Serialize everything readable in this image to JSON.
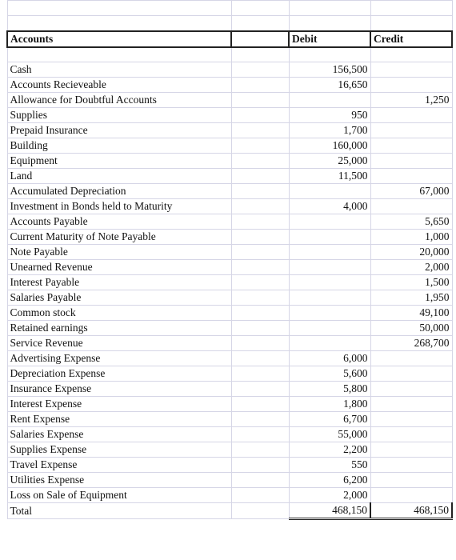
{
  "header": {
    "accounts": "Accounts",
    "blank": "",
    "debit": "Debit",
    "credit": "Credit"
  },
  "rows": [
    {
      "account": "Cash",
      "debit": "156,500",
      "credit": ""
    },
    {
      "account": "Accounts Recieveable",
      "debit": "16,650",
      "credit": ""
    },
    {
      "account": "Allowance for Doubtful Accounts",
      "debit": "",
      "credit": "1,250"
    },
    {
      "account": "Supplies",
      "debit": "950",
      "credit": ""
    },
    {
      "account": "Prepaid Insurance",
      "debit": "1,700",
      "credit": ""
    },
    {
      "account": "Building",
      "debit": "160,000",
      "credit": ""
    },
    {
      "account": "Equipment",
      "debit": "25,000",
      "credit": ""
    },
    {
      "account": "Land",
      "debit": "11,500",
      "credit": ""
    },
    {
      "account": "Accumulated Depreciation",
      "debit": "",
      "credit": "67,000"
    },
    {
      "account": "Investment in Bonds held to Maturity",
      "debit": "4,000",
      "credit": ""
    },
    {
      "account": "Accounts Payable",
      "debit": "",
      "credit": "5,650"
    },
    {
      "account": "Current Maturity of Note Payable",
      "debit": "",
      "credit": "1,000"
    },
    {
      "account": "Note Payable",
      "debit": "",
      "credit": "20,000"
    },
    {
      "account": "Unearned Revenue",
      "debit": "",
      "credit": "2,000"
    },
    {
      "account": "Interest Payable",
      "debit": "",
      "credit": "1,500"
    },
    {
      "account": "Salaries Payable",
      "debit": "",
      "credit": "1,950"
    },
    {
      "account": "Common stock",
      "debit": "",
      "credit": "49,100"
    },
    {
      "account": "Retained earnings",
      "debit": "",
      "credit": "50,000"
    },
    {
      "account": "Service Revenue",
      "debit": "",
      "credit": "268,700"
    },
    {
      "account": "Advertising Expense",
      "debit": "6,000",
      "credit": ""
    },
    {
      "account": "Depreciation Expense",
      "debit": "5,600",
      "credit": ""
    },
    {
      "account": "Insurance Expense",
      "debit": "5,800",
      "credit": ""
    },
    {
      "account": "Interest Expense",
      "debit": "1,800",
      "credit": ""
    },
    {
      "account": "Rent Expense",
      "debit": "6,700",
      "credit": ""
    },
    {
      "account": "Salaries Expense",
      "debit": "55,000",
      "credit": ""
    },
    {
      "account": "Supplies Expense",
      "debit": "2,200",
      "credit": ""
    },
    {
      "account": "Travel Expense",
      "debit": "550",
      "credit": ""
    },
    {
      "account": "Utilities Expense",
      "debit": "6,200",
      "credit": ""
    },
    {
      "account": "Loss on Sale of Equipment",
      "debit": "2,000",
      "credit": ""
    }
  ],
  "total": {
    "label": "Total",
    "debit": "468,150",
    "credit": "468,150"
  }
}
